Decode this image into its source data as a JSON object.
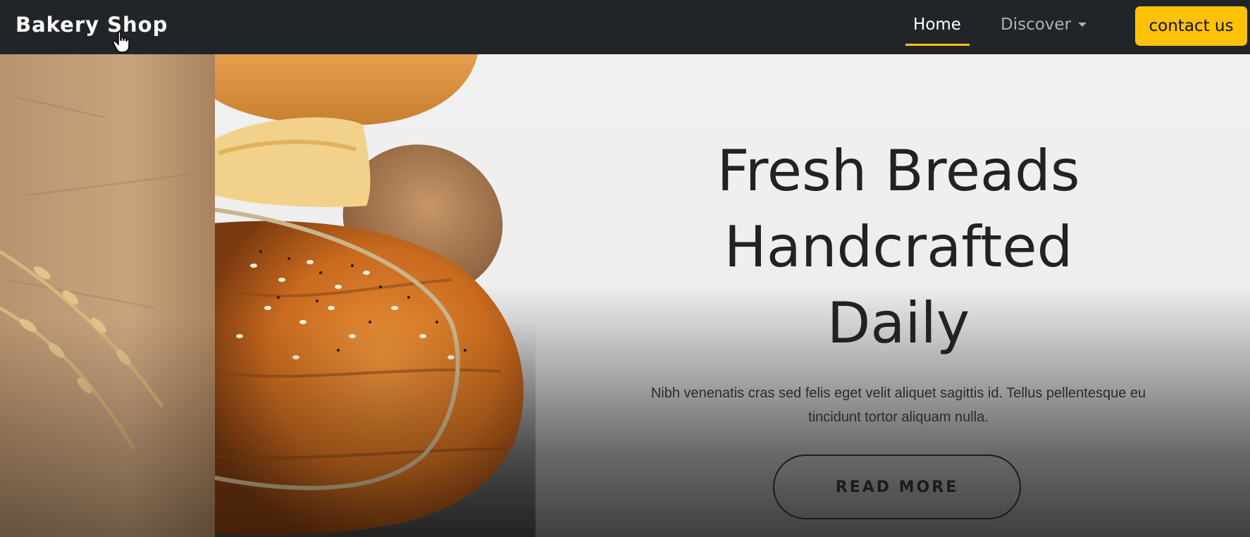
{
  "navbar": {
    "brand": "Bakery Shop",
    "links": {
      "home": "Home",
      "discover": "Discover"
    },
    "contact_label": "contact us"
  },
  "hero": {
    "title_lines": [
      "Fresh Breads",
      "Handcrafted",
      "Daily"
    ],
    "description": "Nibh venenatis cras sed felis eget velit aliquet sagittis id. Tellus pellentesque eu tincidunt tortor aliquam nulla.",
    "cta_label": "READ MORE"
  },
  "colors": {
    "navbar_bg": "#212529",
    "accent": "#ffc107",
    "nav_inactive": "#aeb2b6",
    "hero_text": "#222222"
  },
  "icons": {
    "cursor": "hand-pointer-icon",
    "dropdown": "caret-down-icon"
  }
}
